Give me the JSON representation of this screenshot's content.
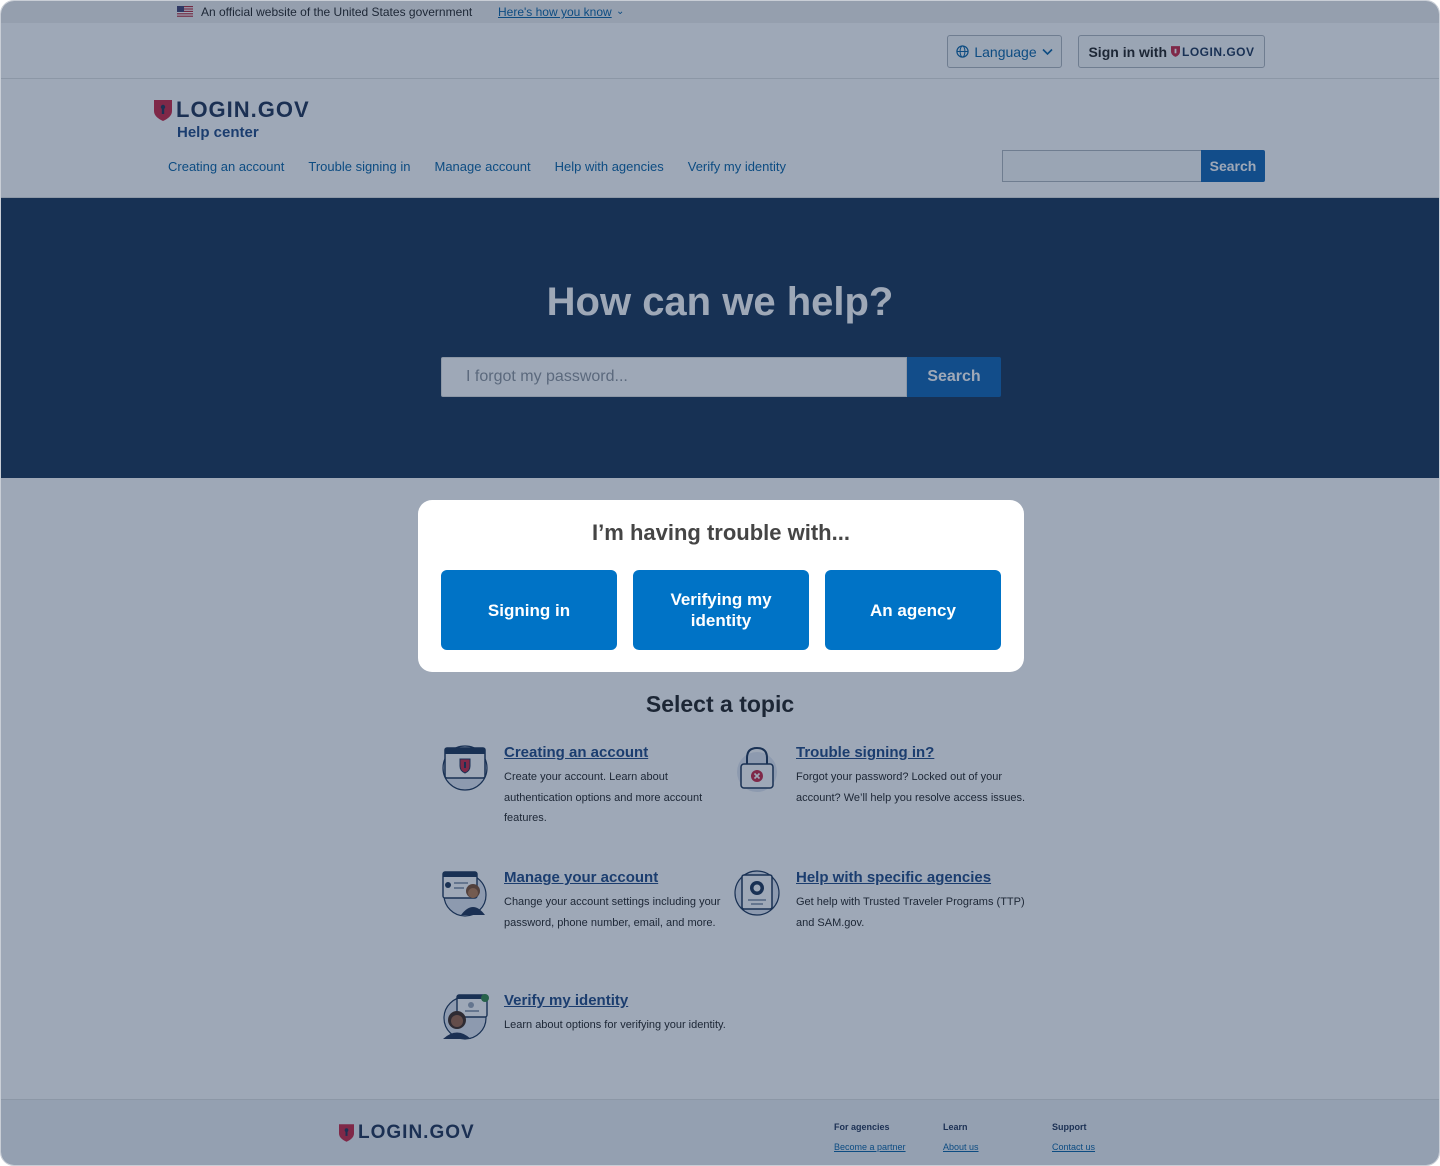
{
  "gov_banner": {
    "official_text": "An official website of the United States government",
    "how_you_know": "Here's how you know"
  },
  "utility": {
    "language_label": "Language",
    "signin_prefix": "Sign in with",
    "signin_logo": "LOGIN.GOV"
  },
  "header": {
    "logo": "LOGIN.GOV",
    "subtitle": "Help center",
    "nav": [
      "Creating an account",
      "Trouble signing in",
      "Manage account",
      "Help with agencies",
      "Verify my identity"
    ],
    "search_label": "Search"
  },
  "hero": {
    "title": "How can we help?",
    "search_placeholder": "I forgot my password...",
    "search_label": "Search"
  },
  "trouble": {
    "title": "I’m having trouble with...",
    "buttons": [
      "Signing in",
      "Verifying my identity",
      "An agency"
    ]
  },
  "topics": {
    "title": "Select a topic",
    "items": [
      {
        "title": "Creating an account",
        "desc": "Create your account. Learn about authentication options and more account features.",
        "icon": "browser-shield-icon"
      },
      {
        "title": "Trouble signing in?",
        "desc": "Forgot your password? Locked out of your account? We’ll help you resolve access issues.",
        "icon": "padlock-error-icon"
      },
      {
        "title": "Manage your account",
        "desc": "Change your account settings including your password, phone number, email, and more.",
        "icon": "account-settings-icon"
      },
      {
        "title": "Help with specific agencies",
        "desc": "Get help with Trusted Traveler Programs (TTP) and SAM.gov.",
        "icon": "agency-badge-icon"
      },
      {
        "title": "Verify my identity",
        "desc": "Learn about options for verifying your identity.",
        "icon": "identity-verified-icon"
      }
    ]
  },
  "footer": {
    "logo": "LOGIN.GOV",
    "columns": [
      {
        "heading": "For agencies",
        "link": "Become a partner"
      },
      {
        "heading": "Learn",
        "link": "About us"
      },
      {
        "heading": "Support",
        "link": "Contact us"
      }
    ]
  },
  "colors": {
    "primary": "#0073c6",
    "hero_bg": "#122e51",
    "brand_red": "#c81e3c",
    "link": "#1a4480"
  }
}
